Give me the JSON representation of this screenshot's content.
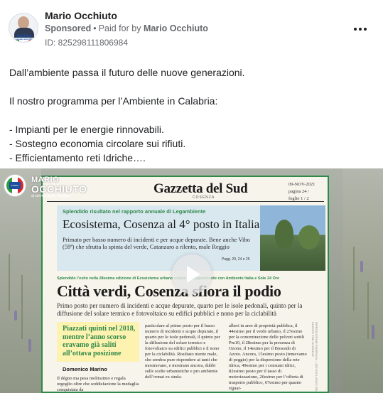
{
  "header": {
    "page_name": "Mario Occhiuto",
    "sponsored_label": "Sponsored",
    "paid_for_by_prefix": "Paid for by",
    "paid_for_by_name": "Mario Occhiuto",
    "ad_id": "ID: 825298111806984",
    "more_icon": "more-horizontal-icon",
    "avatar_text": "MARIO OCCHIUTO"
  },
  "post": {
    "lines": [
      "Dall’ambiente passa il futuro delle nuove generazioni.",
      "",
      "Il nostro programma per l’Ambiente in Calabria:",
      "",
      "- Impianti per le energie rinnovabili.",
      "- Sostegno economia circolare sui rifiuti.",
      "- Efficientamento reti Idriche…."
    ]
  },
  "video": {
    "play_icon": "play-icon",
    "overlay": {
      "line1": "MARIO",
      "line2": "OCCHIUTO",
      "sub": "al servizio della Calabria",
      "logo_text": "FORZA ITALIA"
    },
    "newspaper": {
      "masthead": "Gazzetta del Sud",
      "masthead_sub": "COSENZA",
      "date": "09-NOV-2021",
      "page": "pagina 24 /",
      "sheet": "foglio 1 / 2",
      "box_kicker": "Splendido risultato nel rapporto annuale di Legambiente",
      "box_title": "Ecosistema, Cosenza al 4° posto in Italia",
      "box_body": "Primato per basso numero di incidenti e per acque depurate. Bene anche Vibo (59ª) che sfrutta la spinta del verde, Catanzaro a rilento, male Reggio",
      "box_pages": "Pagg. 20, 24 e 25",
      "main_kicker": "Splendido l’esito nella 28esima edizione di Ecosistema urbano curata da Legambiente con Ambiente Italia e Sole 24 Ore",
      "main_title": "Città verdi, Cosenza sfiora il podio",
      "main_sub": "Primo posto per numero di incidenti e acque depurate, quarto per le isole pedonali, quinto per la diffusione del solare termico e fotovoltaico su edifici pubblici e nono per la ciclabilità",
      "pull_quote": "Piazzati quinti nel 2018, mentre l’anno scorso eravamo già saliti all’ottava posizione",
      "byline": "Domenico Marino",
      "col1": "Il dégno ma pesa moltissimo e regala orgoglio oltre che soddisfazione la medaglia conquistata da",
      "col2": "particolare al primo posto per il basso numero di incidenti e acque depurate, il quarto per le isole pedonali, il quinto per la diffusione del solare termico e fotovoltaico su edifici pubblici e il nono per la ciclabilità. Risultato niente male, che sembra pure rispondere ai tanti che mostravano, e mostrano ancora, dubbi sulle scelte urbanistiche e pro ambiente dell’ormai ex sinda-",
      "col3": "alberi in aree di proprietà pubblica, il 44esimo per il verde urbano, il 27esimo per la concentrazione delle polveri sottili Pm10, il 28esimo per la presenza di Ozono, il 14esimo per il Biossido di Azoto. Ancora, 15esimo posto (temevamo di peggio) per la dispersione della rete idrica, 49esimo per i consumi idrici, 82esimo posto per il tasso di motorizzazione, 26esimo per l’offerta di trasporto pubblico, 67esimo per quanto riguar-",
      "side_strip": "RIPRODUZIONE RISERVATA - USO ESCLUSIVO DEL CLIENTE CHE LO RICEVE"
    }
  }
}
